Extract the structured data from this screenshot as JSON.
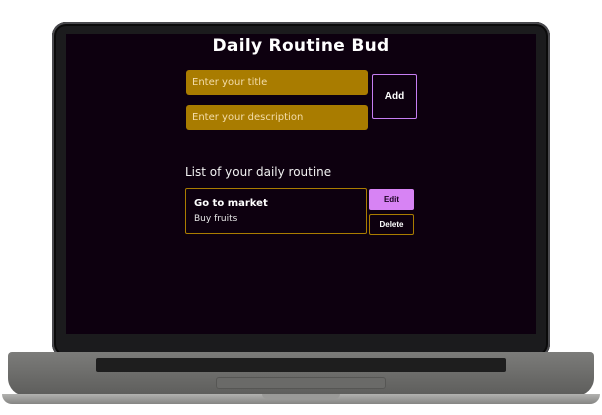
{
  "app": {
    "title": "Daily Routine Bud"
  },
  "form": {
    "title_placeholder": "Enter your title",
    "title_value": "",
    "description_placeholder": "Enter your description",
    "description_value": "",
    "add_label": "Add"
  },
  "list": {
    "heading": "List of your daily routine",
    "items": [
      {
        "title": "Go to market",
        "description": "Buy fruits",
        "edit_label": "Edit",
        "delete_label": "Delete"
      }
    ]
  },
  "colors": {
    "background": "#0d000f",
    "input_fill": "#a97c00",
    "accent_purple": "#d783f4",
    "border_gold": "#a97c00"
  }
}
